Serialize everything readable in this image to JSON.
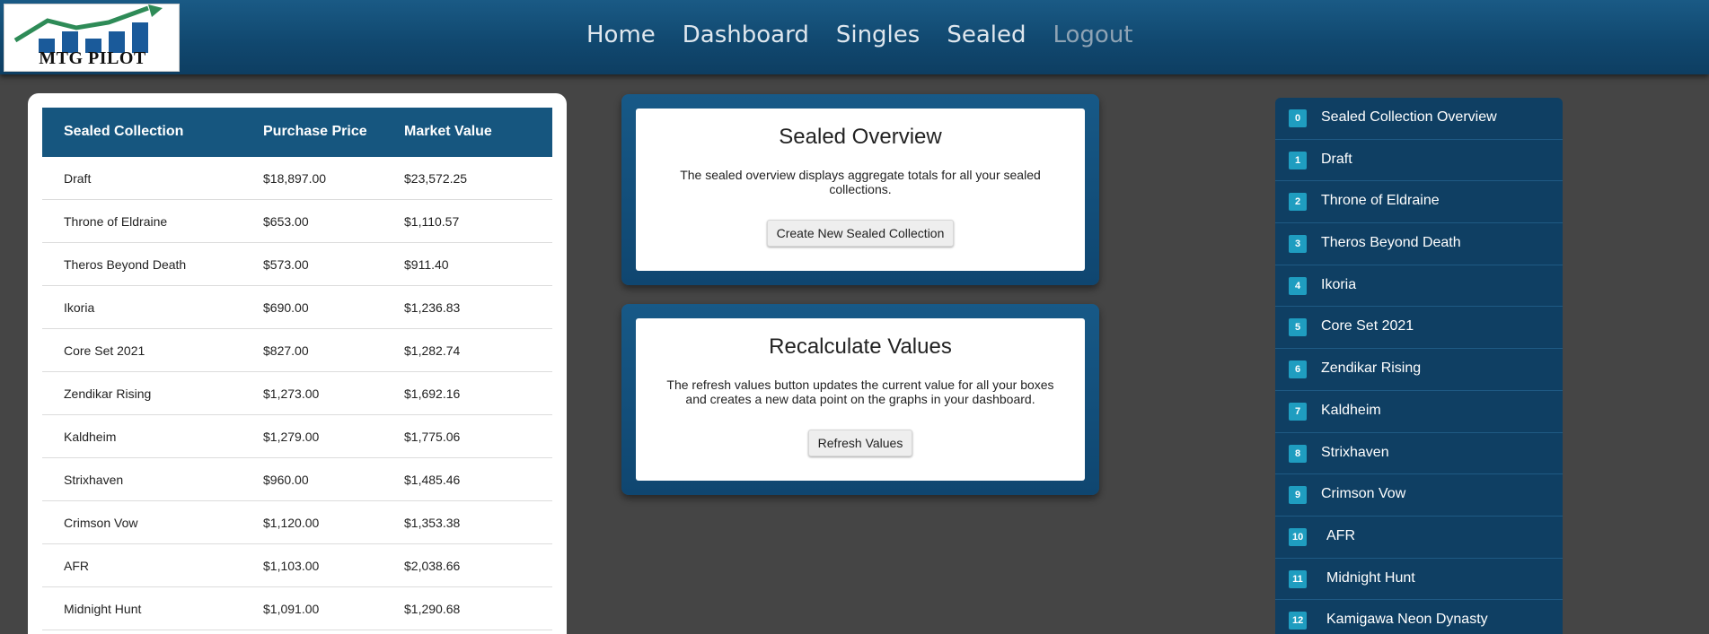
{
  "brand": {
    "logo_text": "MTG PILOT",
    "colors": {
      "logo_green": "#2e8b57",
      "logo_blue": "#1a5a9a"
    }
  },
  "nav": {
    "items": [
      "Home",
      "Dashboard",
      "Singles",
      "Sealed",
      "Logout"
    ]
  },
  "collection_table": {
    "headers": [
      "Sealed Collection",
      "Purchase Price",
      "Market Value"
    ],
    "rows": [
      [
        "Draft",
        "$18,897.00",
        "$23,572.25"
      ],
      [
        "Throne of Eldraine",
        "$653.00",
        "$1,110.57"
      ],
      [
        "Theros Beyond Death",
        "$573.00",
        "$911.40"
      ],
      [
        "Ikoria",
        "$690.00",
        "$1,236.83"
      ],
      [
        "Core Set 2021",
        "$827.00",
        "$1,282.74"
      ],
      [
        "Zendikar Rising",
        "$1,273.00",
        "$1,692.16"
      ],
      [
        "Kaldheim",
        "$1,279.00",
        "$1,775.06"
      ],
      [
        "Strixhaven",
        "$960.00",
        "$1,485.46"
      ],
      [
        "Crimson Vow",
        "$1,120.00",
        "$1,353.38"
      ],
      [
        "AFR",
        "$1,103.00",
        "$2,038.66"
      ],
      [
        "Midnight Hunt",
        "$1,091.00",
        "$1,290.68"
      ]
    ]
  },
  "overview_panel": {
    "title": "Sealed Overview",
    "description": "The sealed overview displays aggregate totals for all your sealed collections.",
    "button": "Create New Sealed Collection"
  },
  "recalc_panel": {
    "title": "Recalculate Values",
    "description": "The refresh values button updates the current value for all your boxes and creates a new data point on the graphs in your dashboard.",
    "button": "Refresh Values"
  },
  "side_list": {
    "items": [
      {
        "badge": "0",
        "label": "Sealed Collection Overview"
      },
      {
        "badge": "1",
        "label": "Draft"
      },
      {
        "badge": "2",
        "label": "Throne of Eldraine"
      },
      {
        "badge": "3",
        "label": "Theros Beyond Death"
      },
      {
        "badge": "4",
        "label": "Ikoria"
      },
      {
        "badge": "5",
        "label": "Core Set 2021"
      },
      {
        "badge": "6",
        "label": "Zendikar Rising"
      },
      {
        "badge": "7",
        "label": "Kaldheim"
      },
      {
        "badge": "8",
        "label": "Strixhaven"
      },
      {
        "badge": "9",
        "label": "Crimson Vow"
      },
      {
        "badge": "10",
        "label": "AFR"
      },
      {
        "badge": "11",
        "label": "Midnight Hunt"
      },
      {
        "badge": "12",
        "label": "Kamigawa Neon Dynasty"
      }
    ]
  }
}
